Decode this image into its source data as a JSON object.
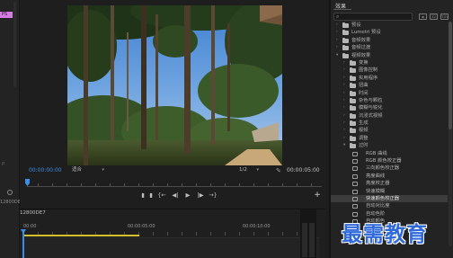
{
  "left_panel": {
    "badge": "PS",
    "label": "P",
    "timecode": "12800DE7"
  },
  "monitor": {
    "current_timecode": "00:00:00:00",
    "fit_select": "适合",
    "resolution_select": "1/2",
    "duration_timecode": "00:00:05:00",
    "transport": {
      "mark_in": "▮",
      "mark_out": "▮",
      "go_to_in": "{←",
      "step_back": "◀|",
      "play": "▶",
      "step_forward": "|▶",
      "go_to_out": "→}",
      "add": "+"
    }
  },
  "timeline": {
    "sequence_label": "12800DE7",
    "ruler_labels": [
      "00:00",
      "00:00:05:00",
      "00:00:10:00"
    ]
  },
  "effects": {
    "title": "效果",
    "search_placeholder": "",
    "items": [
      {
        "label": "预设",
        "level": 0,
        "kind": "folder",
        "expanded": false
      },
      {
        "label": "Lumetri 预设",
        "level": 0,
        "kind": "folder",
        "expanded": false
      },
      {
        "label": "音频效果",
        "level": 0,
        "kind": "folder",
        "expanded": false
      },
      {
        "label": "音频过渡",
        "level": 0,
        "kind": "folder",
        "expanded": false
      },
      {
        "label": "视频效果",
        "level": 0,
        "kind": "folder",
        "expanded": true
      },
      {
        "label": "变换",
        "level": 1,
        "kind": "folder",
        "expanded": false
      },
      {
        "label": "图像控制",
        "level": 1,
        "kind": "folder",
        "expanded": false
      },
      {
        "label": "实用程序",
        "level": 1,
        "kind": "folder",
        "expanded": false
      },
      {
        "label": "扭曲",
        "level": 1,
        "kind": "folder",
        "expanded": false
      },
      {
        "label": "时间",
        "level": 1,
        "kind": "folder",
        "expanded": false
      },
      {
        "label": "杂色与颗粒",
        "level": 1,
        "kind": "folder",
        "expanded": false
      },
      {
        "label": "模糊与锐化",
        "level": 1,
        "kind": "folder",
        "expanded": false
      },
      {
        "label": "沉浸式视频",
        "level": 1,
        "kind": "folder",
        "expanded": false
      },
      {
        "label": "生成",
        "level": 1,
        "kind": "folder",
        "expanded": false
      },
      {
        "label": "视频",
        "level": 1,
        "kind": "folder",
        "expanded": false
      },
      {
        "label": "调整",
        "level": 1,
        "kind": "folder",
        "expanded": false
      },
      {
        "label": "过时",
        "level": 1,
        "kind": "folder",
        "expanded": true
      },
      {
        "label": "RGB 曲线",
        "level": 2,
        "kind": "effect"
      },
      {
        "label": "RGB 颜色校正器",
        "level": 2,
        "kind": "effect"
      },
      {
        "label": "三向颜色校正器",
        "level": 2,
        "kind": "effect"
      },
      {
        "label": "亮度曲线",
        "level": 2,
        "kind": "effect"
      },
      {
        "label": "亮度校正器",
        "level": 2,
        "kind": "effect"
      },
      {
        "label": "快速模糊",
        "level": 2,
        "kind": "effect"
      },
      {
        "label": "快速颜色校正器",
        "level": 2,
        "kind": "effect",
        "selected": true
      },
      {
        "label": "自动对比度",
        "level": 2,
        "kind": "effect"
      },
      {
        "label": "自动色阶",
        "level": 2,
        "kind": "effect"
      },
      {
        "label": "自动颜色",
        "level": 2,
        "kind": "effect"
      },
      {
        "label": "阴影/高光",
        "level": 2,
        "kind": "effect"
      },
      {
        "label": "过渡",
        "level": 1,
        "kind": "folder",
        "expanded": false
      }
    ]
  },
  "watermark": "最需教育",
  "colors": {
    "accent_blue": "#3b8ee6",
    "work_area_yellow": "#d2c02c",
    "badge_pink": "#d47de0",
    "watermark_blue": "#2f69d9"
  }
}
